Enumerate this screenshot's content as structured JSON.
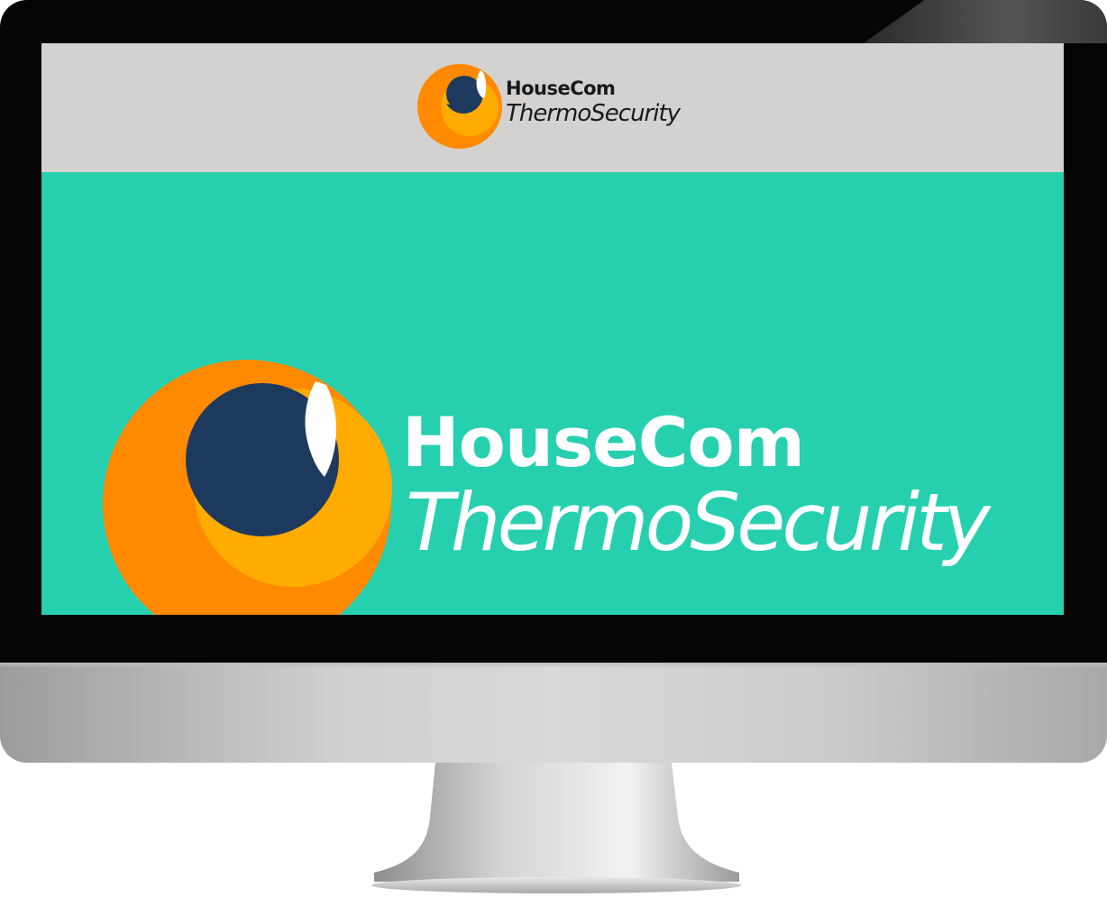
{
  "site": {
    "brand_name": "HouseCom",
    "product_name": "ThermoSecurity"
  },
  "header": {
    "logo_line1": "HouseCom",
    "logo_line2": "ThermoSecurity"
  },
  "hero": {
    "logo_line1": "HouseCom",
    "logo_line2": "ThermoSecurity"
  },
  "colors": {
    "hero_background": "#26d0ae",
    "header_background": "#d3d2d0",
    "logo_outer_orange": "#ff8a00",
    "logo_inner_amber": "#ffab00",
    "logo_navy": "#1d3a5e",
    "logo_highlight": "#ffffff",
    "bezel": "#050505"
  },
  "icons": {
    "logo_mark": "housecom-logo-icon",
    "monitor": "desktop-monitor-frame"
  }
}
